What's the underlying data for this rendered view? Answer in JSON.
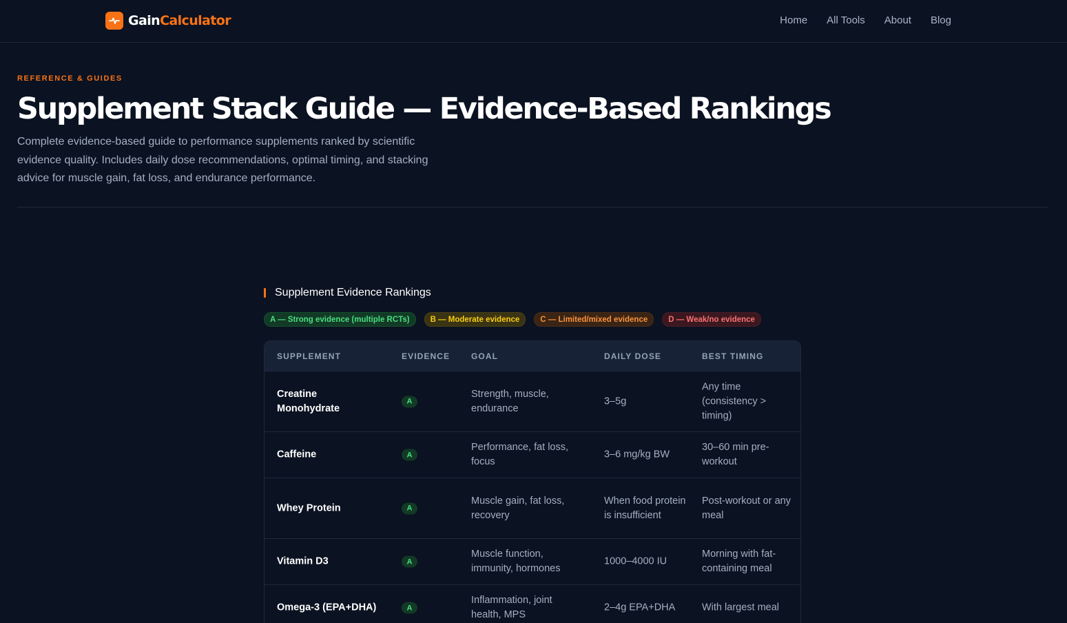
{
  "header": {
    "brand_white": "Gain",
    "brand_orange": "Calculator",
    "nav": [
      "Home",
      "All Tools",
      "About",
      "Blog"
    ]
  },
  "hero": {
    "eyebrow": "REFERENCE & GUIDES",
    "title": "Supplement Stack Guide — Evidence-Based Rankings",
    "intro": "Complete evidence-based guide to performance supplements ranked by scientific evidence quality. Includes daily dose recommendations, optimal timing, and stacking advice for muscle gain, fat loss, and endurance performance."
  },
  "section": {
    "title": "Supplement Evidence Rankings",
    "legend": {
      "a": "A — Strong evidence (multiple RCTs)",
      "b": "B — Moderate evidence",
      "c": "C — Limited/mixed evidence",
      "d": "D — Weak/no evidence"
    }
  },
  "table": {
    "headers": [
      "SUPPLEMENT",
      "EVIDENCE",
      "GOAL",
      "DAILY DOSE",
      "BEST TIMING"
    ],
    "rows": [
      {
        "name": "Creatine Monohydrate",
        "grade": "A",
        "goal": "Strength, muscle, endurance",
        "dose": "3–5g",
        "timing": "Any time (consistency > timing)"
      },
      {
        "name": "Caffeine",
        "grade": "A",
        "goal": "Performance, fat loss, focus",
        "dose": "3–6 mg/kg BW",
        "timing": "30–60 min pre-workout"
      },
      {
        "name": "Whey Protein",
        "grade": "A",
        "goal": "Muscle gain, fat loss, recovery",
        "dose": "When food protein is insufficient",
        "timing": "Post-workout or any meal"
      },
      {
        "name": "Vitamin D3",
        "grade": "A",
        "goal": "Muscle function, immunity, hormones",
        "dose": "1000–4000 IU",
        "timing": "Morning with fat-containing meal"
      },
      {
        "name": "Omega-3 (EPA+DHA)",
        "grade": "A",
        "goal": "Inflammation, joint health, MPS",
        "dose": "2–4g EPA+DHA",
        "timing": "With largest meal"
      }
    ]
  }
}
